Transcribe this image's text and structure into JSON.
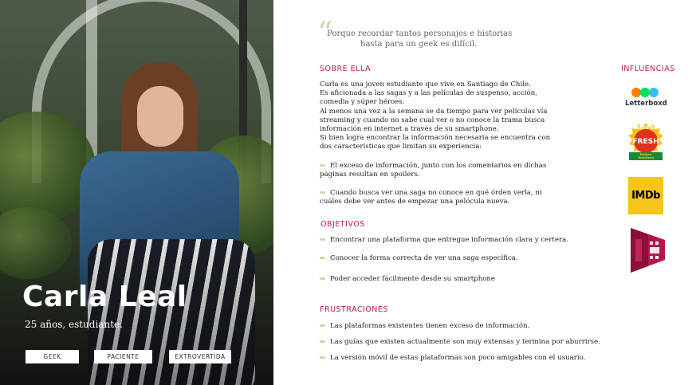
{
  "profile": {
    "name": "Carla Leal",
    "subtitle": "25 años, estudiante.",
    "tags": [
      "GEEK",
      "PACIENTE",
      "EXTROVERTIDA"
    ]
  },
  "quote": {
    "line1": "Porque recordar tantos personajes e historias",
    "line2": "hasta para un geek es difícil."
  },
  "about": {
    "heading": "SOBRE ELLA",
    "lines": [
      "Carla es una joven estudiante que vive en Santiago de Chile.",
      "Es aficionada a las sagas y a las películas de suspenso, acción,",
      "comedia y súper héroes.",
      "Al menos una vez  a la semana se da tiempo para  ver películas vía",
      "streaming y cuando no sabe cual ver o no conoce la trama busca",
      "información en internet a través de su smartphone.",
      "Si bien logra encontrar la  información necesaria se encuentra con",
      "dos características que limitan su experiencia:"
    ],
    "points": [
      {
        "line1": "El exceso de información, junto con los comentarios en dichas",
        "line2": "páginas resultan en spoilers."
      },
      {
        "line1": "Cuando busca ver una saga no conoce en qué órden verla, ni",
        "line2": "cuáles debe ver antes de empezar una  pelócula nueva."
      }
    ]
  },
  "objectives": {
    "heading": "OBJETIVOS",
    "items": [
      "Encontrar una plataforma que entregue información  clara y certera.",
      "Conocer la forma correcta de ver una saga específica.",
      "Poder acceder fácilmente desde su smartphone"
    ]
  },
  "frustrations": {
    "heading": "FRUSTRACIONES",
    "items": [
      "Las  plataformas existentes tienen exceso de información.",
      "Las guías que existen actualmente son muy extensas y termina por aburrirse.",
      "La versión móvil de estas plataformas son poco amigables con el usuario."
    ]
  },
  "influences": {
    "heading": "INFLUENCIAS",
    "letterboxd": "Letterboxd",
    "rt_certified": "CERTIFIED",
    "rt_fresh": "FRESH",
    "rt_brand": "Rotten Tomatoes",
    "imdb": "IMDb"
  },
  "colors": {
    "accent": "#c0195a",
    "bullet": "#c6dca8",
    "imdb": "#f5c518"
  }
}
